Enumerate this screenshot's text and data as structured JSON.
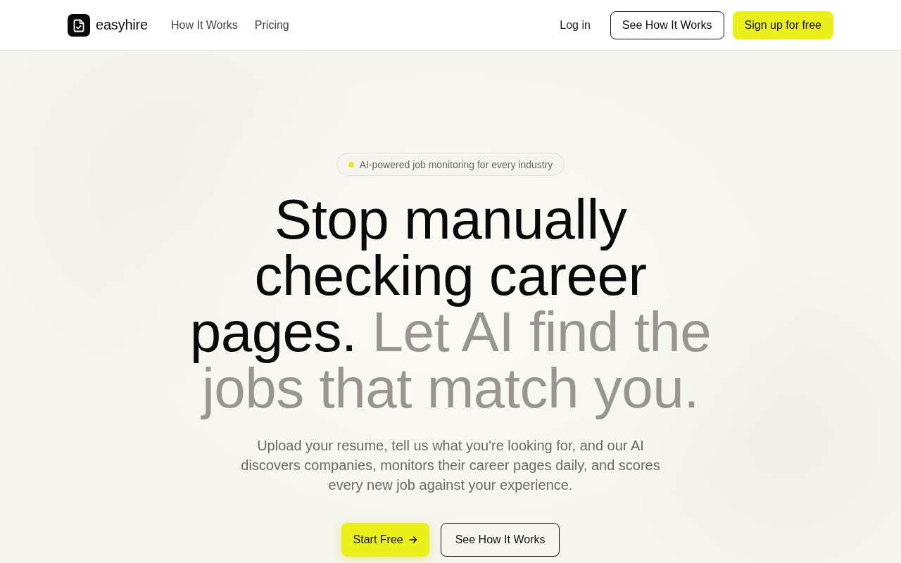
{
  "nav": {
    "logo": {
      "name": "easyhire"
    },
    "links": [
      "How It Works",
      "Pricing"
    ],
    "login": "Log in",
    "buttons": [
      {
        "label": "See How It Works",
        "kind": "outline"
      },
      {
        "label": "Sign up for free",
        "kind": "primary"
      }
    ]
  },
  "hero": {
    "badge": "AI-powered job monitoring for every industry",
    "heading": {
      "lead": "Stop manually checking career pages.",
      "accent": "Let AI find the jobs that match you."
    },
    "subtitle": "Upload your resume, tell us what you're looking for, and our AI discovers companies, monitors their career pages daily, and scores every new job against your experience.",
    "actions": [
      {
        "label": "Start Free",
        "kind": "primary",
        "arrow": true
      },
      {
        "label": "See How It Works",
        "kind": "outline"
      }
    ]
  }
}
